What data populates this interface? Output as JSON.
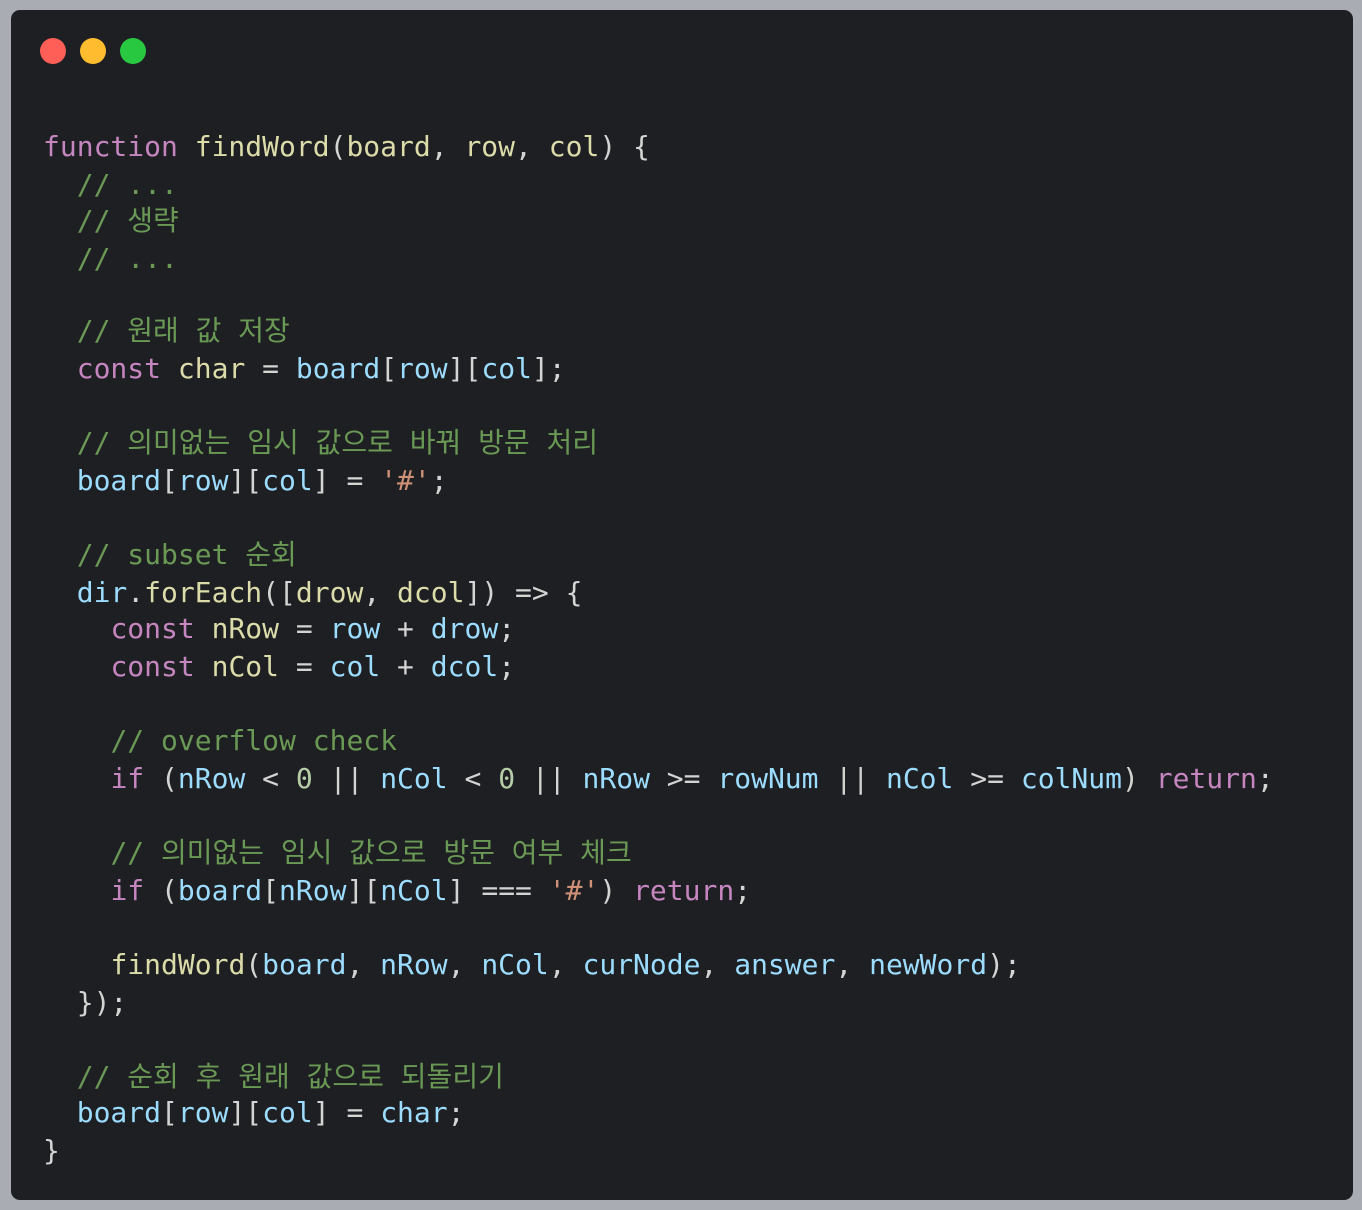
{
  "window": {
    "controls": [
      "close",
      "minimize",
      "zoom"
    ],
    "colors": {
      "close": "#ff5f57",
      "minimize": "#febc2e",
      "zoom": "#28c840",
      "background": "#1e1f22"
    }
  },
  "code": {
    "language": "javascript",
    "lines": [
      [
        [
          "kw",
          "function"
        ],
        [
          "pn",
          " "
        ],
        [
          "fn",
          "findWord"
        ],
        [
          "pn",
          "("
        ],
        [
          "fn",
          "board"
        ],
        [
          "pn",
          ", "
        ],
        [
          "fn",
          "row"
        ],
        [
          "pn",
          ", "
        ],
        [
          "fn",
          "col"
        ],
        [
          "pn",
          ") {"
        ]
      ],
      [
        [
          "pn",
          "  "
        ],
        [
          "cm",
          "// ..."
        ]
      ],
      [
        [
          "pn",
          "  "
        ],
        [
          "cm",
          "// 생략"
        ]
      ],
      [
        [
          "pn",
          "  "
        ],
        [
          "cm",
          "// ..."
        ]
      ],
      [],
      [
        [
          "pn",
          "  "
        ],
        [
          "cm",
          "// 원래 값 저장"
        ]
      ],
      [
        [
          "pn",
          "  "
        ],
        [
          "kw",
          "const"
        ],
        [
          "pn",
          " "
        ],
        [
          "fn",
          "char"
        ],
        [
          "pn",
          " = "
        ],
        [
          "var",
          "board"
        ],
        [
          "pn",
          "["
        ],
        [
          "var",
          "row"
        ],
        [
          "pn",
          "]["
        ],
        [
          "var",
          "col"
        ],
        [
          "pn",
          "];"
        ]
      ],
      [],
      [
        [
          "pn",
          "  "
        ],
        [
          "cm",
          "// 의미없는 임시 값으로 바꿔 방문 처리"
        ]
      ],
      [
        [
          "pn",
          "  "
        ],
        [
          "var",
          "board"
        ],
        [
          "pn",
          "["
        ],
        [
          "var",
          "row"
        ],
        [
          "pn",
          "]["
        ],
        [
          "var",
          "col"
        ],
        [
          "pn",
          "] = "
        ],
        [
          "str",
          "'#'"
        ],
        [
          "pn",
          ";"
        ]
      ],
      [],
      [
        [
          "pn",
          "  "
        ],
        [
          "cm",
          "// subset 순회"
        ]
      ],
      [
        [
          "pn",
          "  "
        ],
        [
          "var",
          "dir"
        ],
        [
          "pn",
          "."
        ],
        [
          "fn",
          "forEach"
        ],
        [
          "pn",
          "(["
        ],
        [
          "fn",
          "drow"
        ],
        [
          "pn",
          ", "
        ],
        [
          "fn",
          "dcol"
        ],
        [
          "pn",
          "]) => {"
        ]
      ],
      [
        [
          "pn",
          "    "
        ],
        [
          "kw",
          "const"
        ],
        [
          "pn",
          " "
        ],
        [
          "fn",
          "nRow"
        ],
        [
          "pn",
          " = "
        ],
        [
          "var",
          "row"
        ],
        [
          "pn",
          " + "
        ],
        [
          "var",
          "drow"
        ],
        [
          "pn",
          ";"
        ]
      ],
      [
        [
          "pn",
          "    "
        ],
        [
          "kw",
          "const"
        ],
        [
          "pn",
          " "
        ],
        [
          "fn",
          "nCol"
        ],
        [
          "pn",
          " = "
        ],
        [
          "var",
          "col"
        ],
        [
          "pn",
          " + "
        ],
        [
          "var",
          "dcol"
        ],
        [
          "pn",
          ";"
        ]
      ],
      [],
      [
        [
          "pn",
          "    "
        ],
        [
          "cm",
          "// overflow check"
        ]
      ],
      [
        [
          "pn",
          "    "
        ],
        [
          "kw",
          "if"
        ],
        [
          "pn",
          " ("
        ],
        [
          "var",
          "nRow"
        ],
        [
          "pn",
          " < "
        ],
        [
          "num",
          "0"
        ],
        [
          "pn",
          " || "
        ],
        [
          "var",
          "nCol"
        ],
        [
          "pn",
          " < "
        ],
        [
          "num",
          "0"
        ],
        [
          "pn",
          " || "
        ],
        [
          "var",
          "nRow"
        ],
        [
          "pn",
          " >= "
        ],
        [
          "var",
          "rowNum"
        ],
        [
          "pn",
          " || "
        ],
        [
          "var",
          "nCol"
        ],
        [
          "pn",
          " >= "
        ],
        [
          "var",
          "colNum"
        ],
        [
          "pn",
          ") "
        ],
        [
          "kw",
          "return"
        ],
        [
          "pn",
          ";"
        ]
      ],
      [],
      [
        [
          "pn",
          "    "
        ],
        [
          "cm",
          "// 의미없는 임시 값으로 방문 여부 체크"
        ]
      ],
      [
        [
          "pn",
          "    "
        ],
        [
          "kw",
          "if"
        ],
        [
          "pn",
          " ("
        ],
        [
          "var",
          "board"
        ],
        [
          "pn",
          "["
        ],
        [
          "var",
          "nRow"
        ],
        [
          "pn",
          "]["
        ],
        [
          "var",
          "nCol"
        ],
        [
          "pn",
          "] === "
        ],
        [
          "str",
          "'#'"
        ],
        [
          "pn",
          ") "
        ],
        [
          "kw",
          "return"
        ],
        [
          "pn",
          ";"
        ]
      ],
      [],
      [
        [
          "pn",
          "    "
        ],
        [
          "fn",
          "findWord"
        ],
        [
          "pn",
          "("
        ],
        [
          "var",
          "board"
        ],
        [
          "pn",
          ", "
        ],
        [
          "var",
          "nRow"
        ],
        [
          "pn",
          ", "
        ],
        [
          "var",
          "nCol"
        ],
        [
          "pn",
          ", "
        ],
        [
          "var",
          "curNode"
        ],
        [
          "pn",
          ", "
        ],
        [
          "var",
          "answer"
        ],
        [
          "pn",
          ", "
        ],
        [
          "var",
          "newWord"
        ],
        [
          "pn",
          ");"
        ]
      ],
      [
        [
          "pn",
          "  });"
        ]
      ],
      [],
      [
        [
          "pn",
          "  "
        ],
        [
          "cm",
          "// 순회 후 원래 값으로 되돌리기"
        ]
      ],
      [
        [
          "pn",
          "  "
        ],
        [
          "var",
          "board"
        ],
        [
          "pn",
          "["
        ],
        [
          "var",
          "row"
        ],
        [
          "pn",
          "]["
        ],
        [
          "var",
          "col"
        ],
        [
          "pn",
          "] = "
        ],
        [
          "var",
          "char"
        ],
        [
          "pn",
          ";"
        ]
      ],
      [
        [
          "pn",
          "}"
        ]
      ]
    ]
  }
}
